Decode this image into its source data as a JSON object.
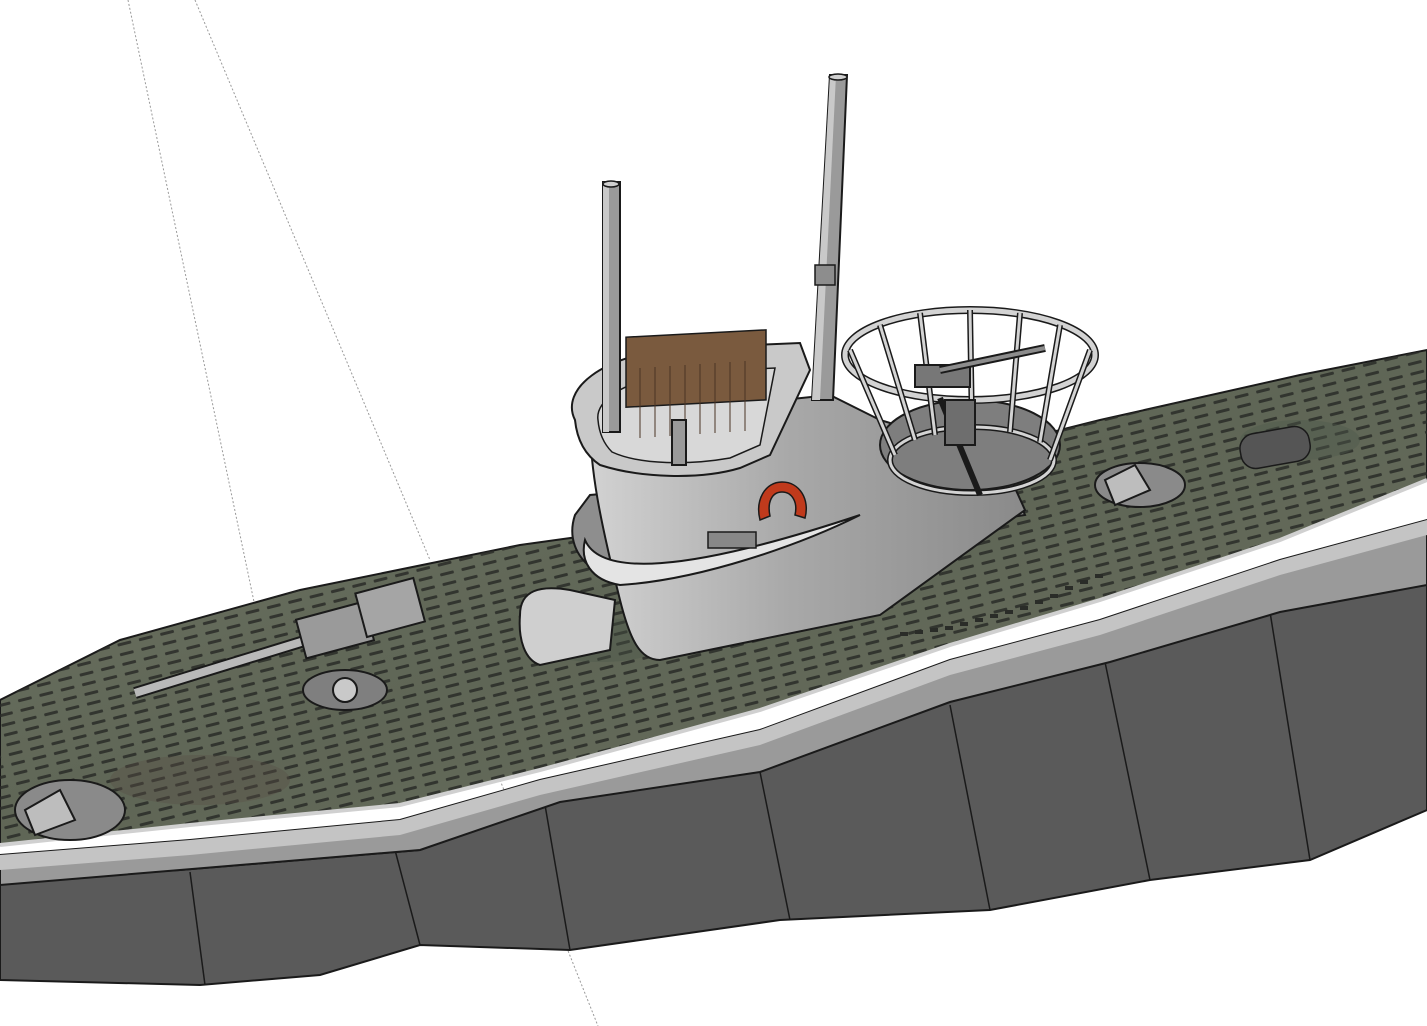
{
  "scene": {
    "subject": "submarine-3d-model",
    "background_color": "#ffffff",
    "colors": {
      "hull_dark": "#5a5a5a",
      "hull_side": "#7a7a7a",
      "hull_light": "#b4b4b4",
      "deck": "#6b6f5e",
      "deck_shadow": "#4e5247",
      "slot": "#2a2c28",
      "tower": "#a9a9a9",
      "tower_light": "#cfcfcf",
      "tower_dark": "#7d7d7d",
      "wood": "#7a5a3e",
      "lifering": "#c03a1c",
      "outline": "#1a1a1a",
      "axis": "#9a9a9a"
    },
    "icons": [
      "submarine-icon",
      "periscope-icon",
      "deck-gun-icon",
      "flak-gun-icon",
      "hatch-icon",
      "life-ring-icon"
    ]
  }
}
